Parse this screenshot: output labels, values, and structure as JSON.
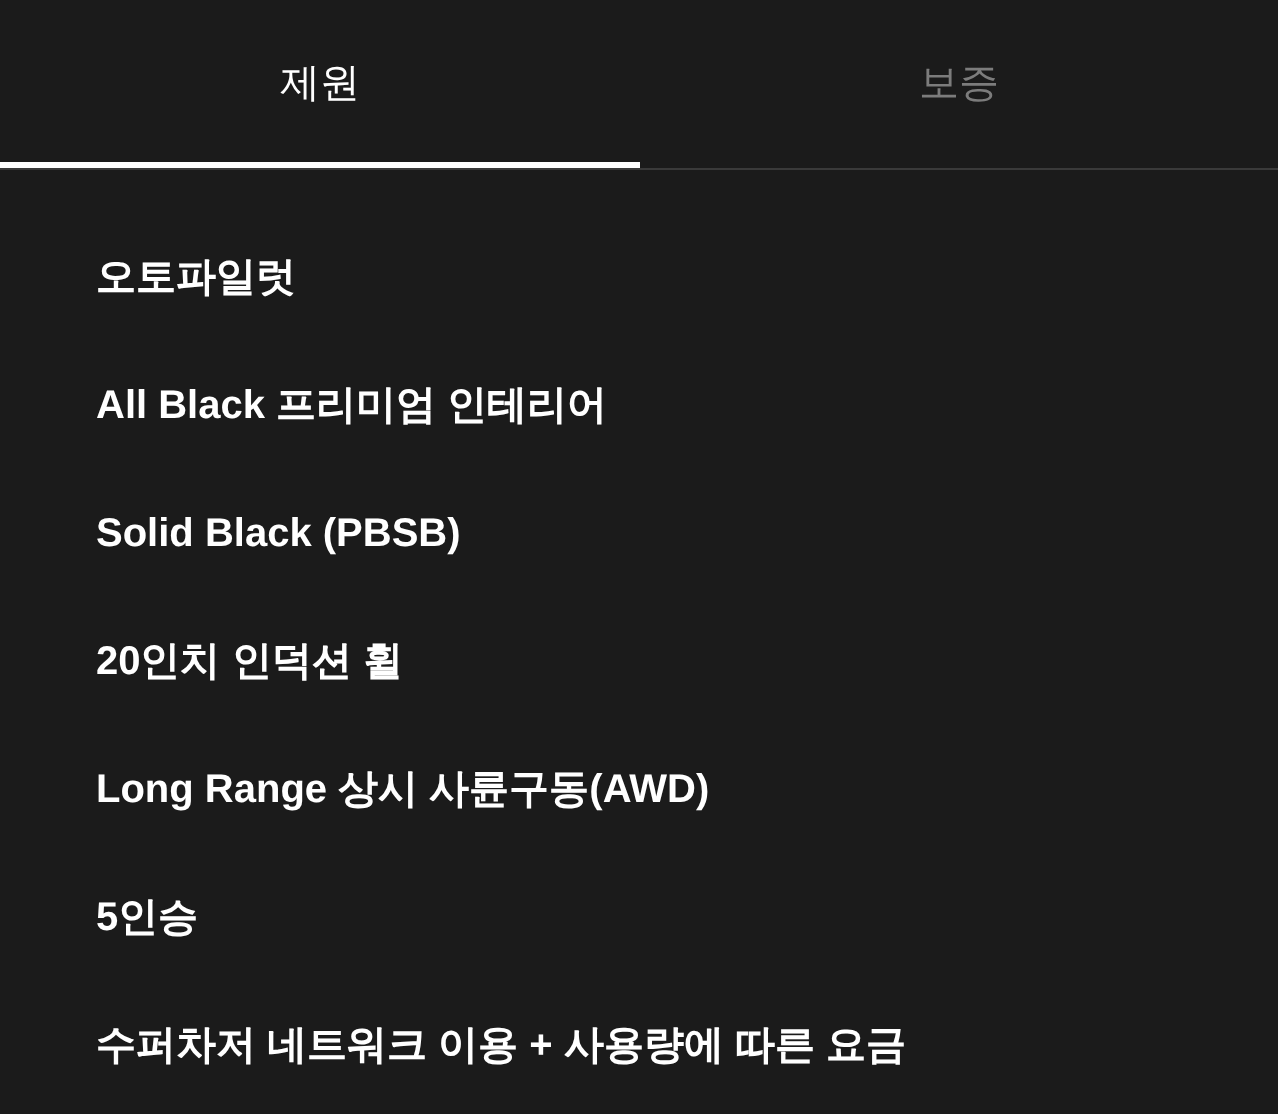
{
  "tabs": [
    {
      "label": "제원",
      "selected": true
    },
    {
      "label": "보증",
      "selected": false
    }
  ],
  "specs": [
    "오토파일럿",
    "All Black 프리미엄 인테리어",
    "Solid Black (PBSB)",
    "20인치 인덕션 휠",
    "Long Range 상시 사륜구동(AWD)",
    "5인승",
    "수퍼차저 네트워크 이용 + 사용량에 따른 요금"
  ]
}
